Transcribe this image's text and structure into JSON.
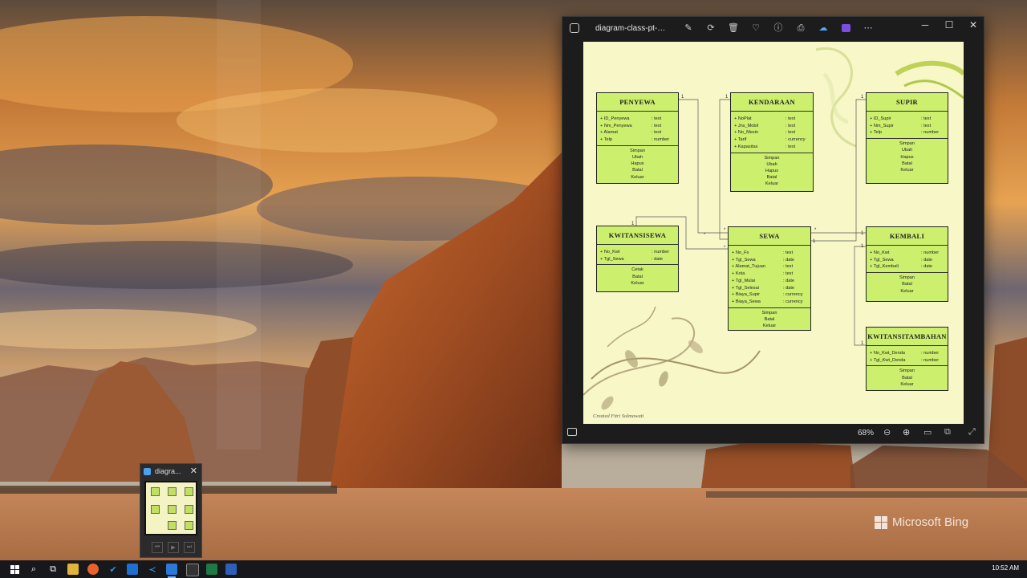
{
  "window": {
    "title": "diagram-class-pt-ben...",
    "zoom": "68%"
  },
  "toolbar_icons": [
    "edit-icon",
    "rotate-icon",
    "delete-icon",
    "favorite-icon",
    "info-icon",
    "print-icon",
    "onedrive-icon",
    "clipchamp-icon",
    "more-icon"
  ],
  "diagram": {
    "classes": [
      {
        "name": "PENYEWA",
        "attrs": [
          [
            "ID_Penyewa",
            ": text"
          ],
          [
            "Nm_Penyewa",
            ": text"
          ],
          [
            "Alamat",
            ": text"
          ],
          [
            "Telp",
            ": number"
          ]
        ],
        "ops": [
          "Simpan",
          "Ubah",
          "Hapus",
          "Batal",
          "Keluar"
        ]
      },
      {
        "name": "KENDARAAN",
        "attrs": [
          [
            "NoPlat",
            ": text"
          ],
          [
            "Jns_Mobil",
            ": text"
          ],
          [
            "No_Mesin",
            ": text"
          ],
          [
            "Tarif",
            ": currency"
          ],
          [
            "Kapasitas",
            ": text"
          ]
        ],
        "ops": [
          "Simpan",
          "Ubah",
          "Hapus",
          "Batal",
          "Keluar"
        ]
      },
      {
        "name": "SUPIR",
        "attrs": [
          [
            "ID_Supir",
            ": text"
          ],
          [
            "Nm_Supir",
            ": text"
          ],
          [
            "Telp",
            ": number"
          ]
        ],
        "ops": [
          "Simpan",
          "Ubah",
          "Hapus",
          "Batal",
          "Keluar"
        ]
      },
      {
        "name": "KWITANSISEWA",
        "attrs": [
          [
            "No_Kwt",
            ": number"
          ],
          [
            "Tgl_Sewa",
            ": date"
          ]
        ],
        "ops": [
          "Cetak",
          "Batal",
          "Keluar"
        ]
      },
      {
        "name": "SEWA",
        "attrs": [
          [
            "No_Fs",
            ": text"
          ],
          [
            "Tgl_Sewa",
            ": date"
          ],
          [
            "Alamat_Tujuan",
            ": text"
          ],
          [
            "Kota",
            ": text"
          ],
          [
            "Tgl_Mulai",
            ": date"
          ],
          [
            "Tgl_Selesai",
            ": date"
          ],
          [
            "Biaya_Supir",
            ": currency"
          ],
          [
            "Biaya_Sewa",
            ": currency"
          ]
        ],
        "ops": [
          "Simpan",
          "Batal",
          "Keluar"
        ]
      },
      {
        "name": "KEMBALI",
        "attrs": [
          [
            "No_Kwt",
            ": number"
          ],
          [
            "Tgl_Sewa",
            ": date"
          ],
          [
            "Tgl_Kembali",
            ": date"
          ]
        ],
        "ops": [
          "Simpan",
          "Batal",
          "Keluar"
        ]
      },
      {
        "name": "KWITANSITAMBAHAN",
        "attrs": [
          [
            "No_Kwt_Denda",
            ": number"
          ],
          [
            "Tgl_Kwt_Denda",
            ": number"
          ]
        ],
        "ops": [
          "Simpan",
          "Batal",
          "Keluar"
        ]
      }
    ],
    "multiplicities": [
      "1",
      "1",
      "1",
      "1",
      "*",
      "*",
      "1",
      "1",
      "*",
      "*",
      "1",
      "1"
    ],
    "credit": "Created Fitri Sulmawati"
  },
  "thumbnail_popup": {
    "title": "diagra..."
  },
  "watermark": "Microsoft Bing",
  "taskbar": {
    "apps": [
      "start",
      "search",
      "task-view",
      "file-explorer",
      "firefox",
      "todo",
      "vscode",
      "photos",
      "terminal",
      "excel",
      "app-blue"
    ],
    "clock": "10:52 AM"
  }
}
